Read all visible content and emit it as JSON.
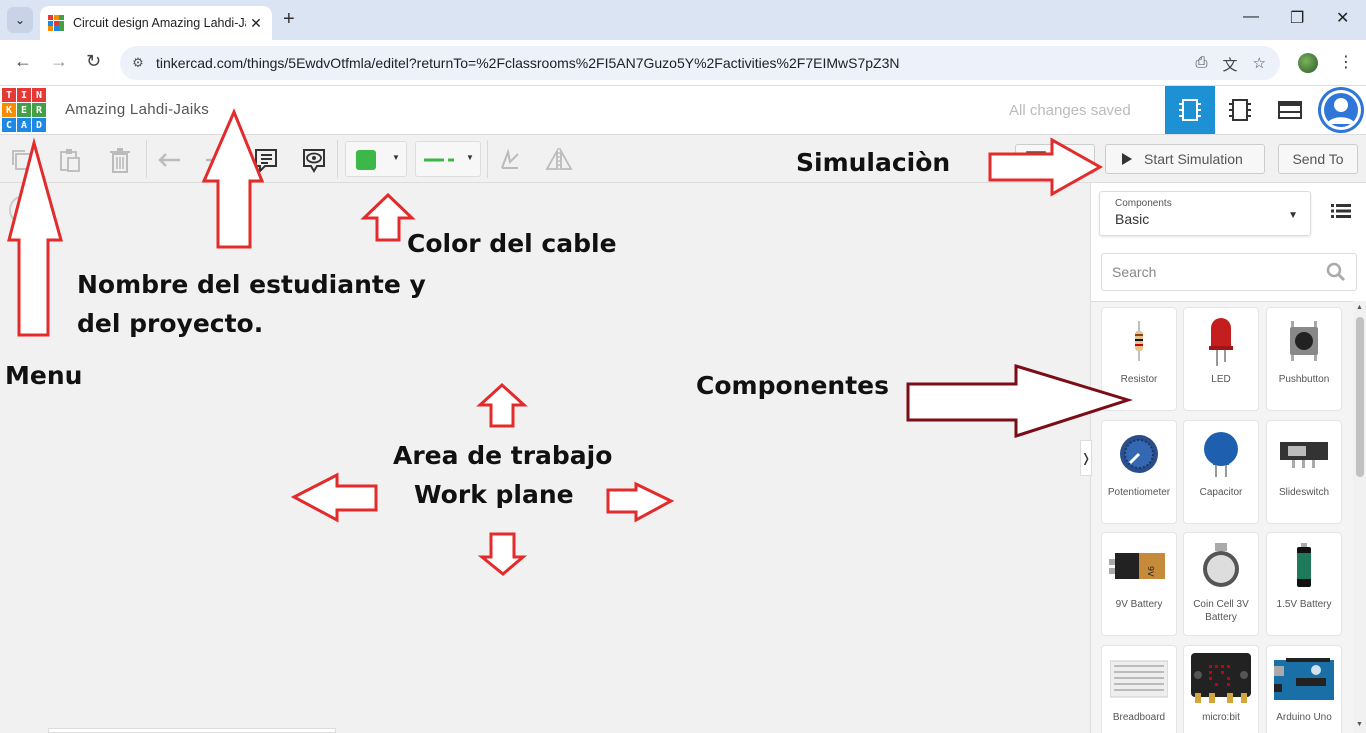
{
  "browser": {
    "tab_title": "Circuit design Amazing Lahdi-Ja",
    "url": "tinkercad.com/things/5EwdvOtfmla/editel?returnTo=%2Fclassrooms%2FI5AN7Guzo5Y%2Factivities%2F7EIMwS7pZ3N",
    "icons": [
      "tab-list-icon",
      "close-tab-icon",
      "new-tab-icon",
      "minimize-icon",
      "restore-icon",
      "close-window-icon",
      "back-icon",
      "forward-icon",
      "reload-icon",
      "site-info-icon",
      "install-icon",
      "translate-icon",
      "bookmark-star-icon",
      "profile-icon",
      "menu-icon"
    ]
  },
  "header": {
    "logo_letters": [
      "T",
      "I",
      "N",
      "K",
      "E",
      "R",
      "C",
      "A",
      "D"
    ],
    "project_name": "Amazing Lahdi-Jaiks",
    "status": "All changes saved",
    "accent": "#1e90d4"
  },
  "toolbar": {
    "wire_color": "#3cb84a",
    "code_label": "Code",
    "sim_label": "Start Simulation",
    "send_label": "Send To"
  },
  "panel": {
    "components_label": "Components",
    "components_value": "Basic",
    "search_placeholder": "Search",
    "items": [
      {
        "label": "Resistor"
      },
      {
        "label": "LED"
      },
      {
        "label": "Pushbutton"
      },
      {
        "label": "Potentiometer"
      },
      {
        "label": "Capacitor"
      },
      {
        "label": "Slideswitch"
      },
      {
        "label": "9V Battery"
      },
      {
        "label": "Coin Cell 3V Battery"
      },
      {
        "label": "1.5V Battery"
      },
      {
        "label": "Breadboard"
      },
      {
        "label": "micro:bit"
      },
      {
        "label": "Arduino Uno"
      }
    ]
  },
  "annotations": {
    "simulacion": "Simulaciòn",
    "color_cable": "Color del cable",
    "nombre_1": "Nombre del estudiante y",
    "nombre_2": "del proyecto.",
    "menu": "Menu",
    "componentes": "Componentes",
    "area_1": "Area de trabajo",
    "area_2": "Work plane",
    "arrow_color": "#e32b2b",
    "arrow_color_dark": "#7a0d16"
  }
}
